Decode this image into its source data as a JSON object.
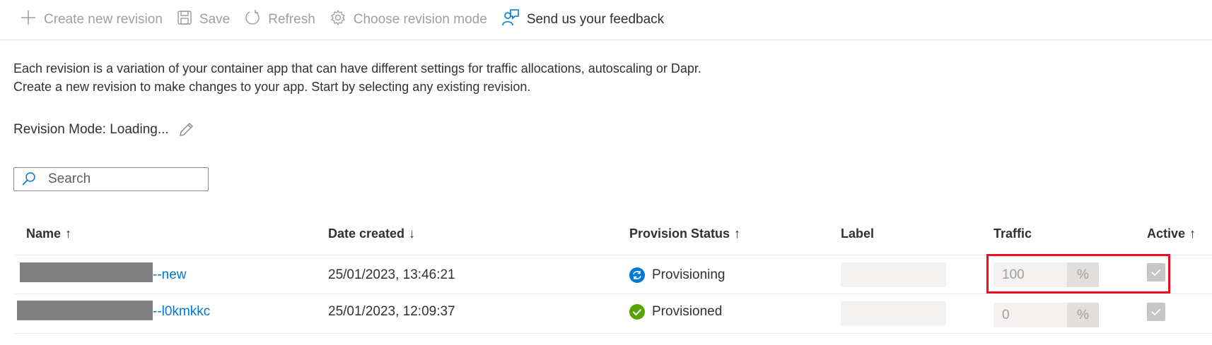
{
  "toolbar": {
    "create_label": "Create new revision",
    "save_label": "Save",
    "refresh_label": "Refresh",
    "choose_mode_label": "Choose revision mode",
    "feedback_label": "Send us your feedback"
  },
  "description": {
    "line1": "Each revision is a variation of your container app that can have different settings for traffic allocations, autoscaling or Dapr.",
    "line2": "Create a new revision to make changes to your app. Start by selecting any existing revision."
  },
  "revision_mode": {
    "label": "Revision Mode",
    "value": ": Loading..."
  },
  "search": {
    "placeholder": "Search"
  },
  "table": {
    "columns": [
      {
        "label": "Name",
        "sort": "↑"
      },
      {
        "label": "Date created",
        "sort": "↓"
      },
      {
        "label": "Provision Status",
        "sort": "↑"
      },
      {
        "label": "Label",
        "sort": ""
      },
      {
        "label": "Traffic",
        "sort": ""
      },
      {
        "label": "Active",
        "sort": "↑"
      }
    ],
    "rows": [
      {
        "name_suffix": "--new",
        "date": "25/01/2023, 13:46:21",
        "status": "Provisioning",
        "status_icon": "sync-icon",
        "status_color": "#0078d4",
        "traffic": "100",
        "traffic_unit": "%",
        "active": true
      },
      {
        "name_suffix": "--l0kmkkc",
        "date": "25/01/2023, 12:09:37",
        "status": "Provisioned",
        "status_icon": "check-circle-icon",
        "status_color": "#57a300",
        "traffic": "0",
        "traffic_unit": "%",
        "active": true
      }
    ]
  },
  "colors": {
    "accent": "#0078d4",
    "highlight_border": "#e81123",
    "disabled_text": "#a19f9d"
  }
}
